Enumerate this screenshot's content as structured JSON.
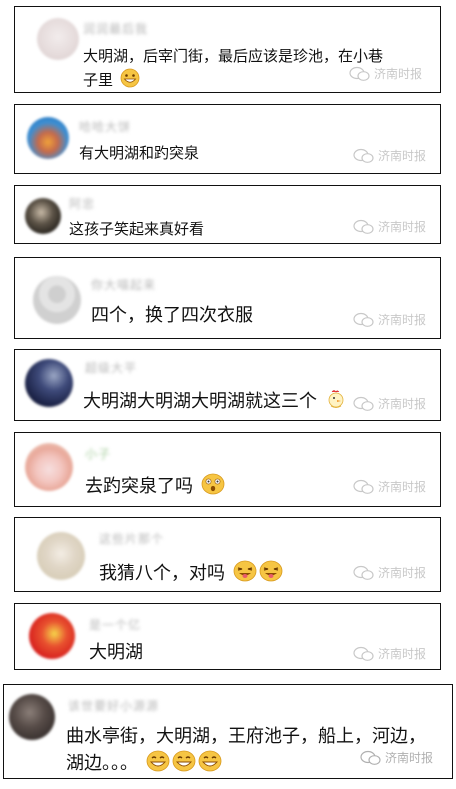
{
  "watermark": "济南时报",
  "comments": [
    {
      "user": "润润最后我",
      "text_lines": [
        "大明湖，后宰门街，最后应该是珍池，在小巷",
        "子里"
      ],
      "emoji": "grin-emoji"
    },
    {
      "user": "哈哈大饼",
      "text_lines": [
        "有大明湖和趵突泉"
      ],
      "emoji": ""
    },
    {
      "user": "阿忠",
      "text_lines": [
        "这孩子笑起来真好看"
      ],
      "emoji": ""
    },
    {
      "user": "你大喵起来",
      "text_lines": [
        "四个，换了四次衣服"
      ],
      "emoji": ""
    },
    {
      "user": "超级大平",
      "text_lines": [
        "大明湖大明湖大明湖就这三个"
      ],
      "emoji": "rooster-emoji"
    },
    {
      "user": "小子",
      "text_lines": [
        "去趵突泉了吗"
      ],
      "emoji": "surprised-emoji"
    },
    {
      "user": "这些片那个",
      "text_lines": [
        "我猜八个，对吗"
      ],
      "emoji": "wink-tongue-emoji"
    },
    {
      "user": "是一个亿",
      "text_lines": [
        "大明湖"
      ],
      "emoji": ""
    },
    {
      "user": "该世要好小源源",
      "text_lines": [
        "曲水亭街，大明湖，王府池子，船上，河边，",
        "湖边。。。"
      ],
      "emoji": "grin-emoji"
    }
  ]
}
